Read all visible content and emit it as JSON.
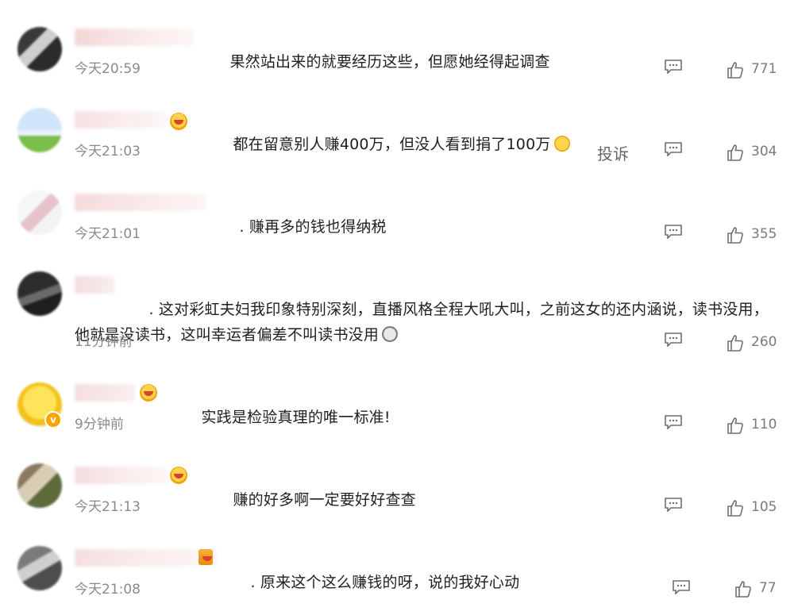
{
  "comments": [
    {
      "text": "果然站出来的就要经历这些，但愿她经得起调查",
      "time": "今天20:59",
      "likes": "771",
      "show_report": false
    },
    {
      "text": "都在留意别人赚400万，但没人看到捐了100万",
      "time": "今天21:03",
      "likes": "304",
      "report_label": "投诉",
      "show_report": true
    },
    {
      "text": "赚再多的钱也得纳税",
      "time": "今天21:01",
      "likes": "355",
      "show_report": false
    },
    {
      "text_line1": "这对彩虹夫妇我印象特别深刻，直播风格全程大吼大叫，之前这女的还内涵说，读书没用，他就",
      "text_line2": "是没读书，这叫幸运者偏差不叫读书没用",
      "time": "11分钟前",
      "likes": "260",
      "show_report": false
    },
    {
      "text": "实践是检验真理的唯一标准!",
      "time": "9分钟前",
      "likes": "110",
      "show_report": false
    },
    {
      "text": "赚的好多啊一定要好好查查",
      "time": "今天21:13",
      "likes": "105",
      "show_report": false
    },
    {
      "text": "原来这个这么赚钱的呀，说的我好心动",
      "time": "今天21:08",
      "likes": "77",
      "show_report": false
    }
  ],
  "icons": {
    "reply": "comment-bubble-icon",
    "like": "thumbs-up-icon",
    "avatar": "blurred-avatar",
    "badge": "fan-badge-icon",
    "emoji": "emoji-icon"
  },
  "colors": {
    "text": "#1f1f1f",
    "meta": "#8a8a8a",
    "icon": "#6f6f6f"
  }
}
